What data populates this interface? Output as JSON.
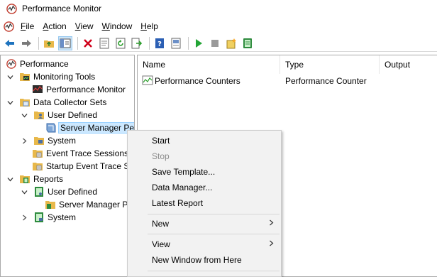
{
  "window": {
    "title": "Performance Monitor",
    "icon": "perfmon-icon"
  },
  "menubar": {
    "items": [
      {
        "label": "File",
        "name": "menu-file"
      },
      {
        "label": "Action",
        "name": "menu-action"
      },
      {
        "label": "View",
        "name": "menu-view"
      },
      {
        "label": "Window",
        "name": "menu-window"
      },
      {
        "label": "Help",
        "name": "menu-help"
      }
    ]
  },
  "toolbar": {
    "buttons": [
      "back-icon",
      "forward-icon",
      "up-folder-icon",
      "show-hide-tree-icon",
      "delete-icon",
      "properties-icon",
      "refresh-icon",
      "export-list-icon",
      "help-icon",
      "mmc-icon",
      "start-icon",
      "stop-icon",
      "new-icon",
      "data-manager-icon"
    ]
  },
  "tree": {
    "items": [
      {
        "label": "Performance"
      },
      {
        "label": "Monitoring Tools"
      },
      {
        "label": "Performance Monitor"
      },
      {
        "label": "Data Collector Sets"
      },
      {
        "label": "User Defined"
      },
      {
        "label": "Server Manager Per"
      },
      {
        "label": "System"
      },
      {
        "label": "Event Trace Sessions"
      },
      {
        "label": "Startup Event Trace Se"
      },
      {
        "label": "Reports"
      },
      {
        "label": "User Defined"
      },
      {
        "label": "Server Manager Pe"
      },
      {
        "label": "System"
      }
    ]
  },
  "list": {
    "columns": [
      "Name",
      "Type",
      "Output"
    ],
    "rows": [
      {
        "name": "Performance Counters",
        "type": "Performance Counter",
        "output": ""
      }
    ]
  },
  "context_menu": {
    "items": [
      {
        "label": "Start"
      },
      {
        "label": "Stop"
      },
      {
        "label": "Save Template..."
      },
      {
        "label": "Data Manager..."
      },
      {
        "label": "Latest Report"
      },
      {
        "label": "New"
      },
      {
        "label": "View"
      },
      {
        "label": "New Window from Here"
      }
    ]
  },
  "colors": {
    "accent": "#0078d7",
    "selection": "#cce8ff",
    "menu_bg": "#f2f2f2"
  }
}
